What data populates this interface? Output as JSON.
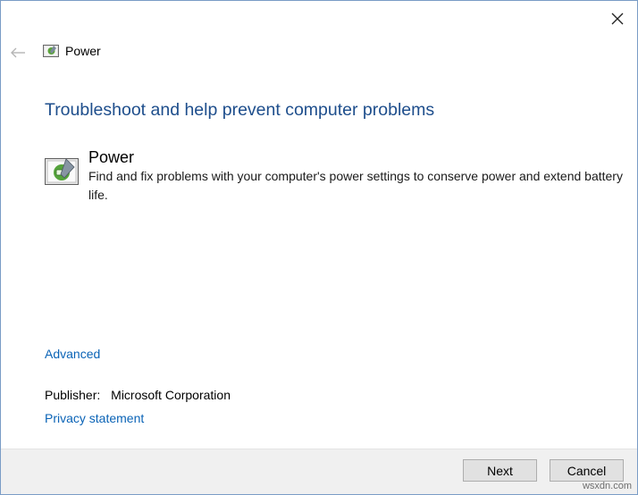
{
  "window": {
    "nav_title": "Power",
    "nav_icon": "power-troubleshooter-icon",
    "back_icon": "back-arrow-icon",
    "close_icon": "close-icon"
  },
  "main": {
    "heading": "Troubleshoot and help prevent computer problems",
    "item": {
      "icon": "battery-troubleshooter-icon",
      "title": "Power",
      "description": "Find and fix problems with your computer's power settings to conserve power and extend battery life."
    },
    "advanced_link": "Advanced",
    "publisher_label": "Publisher:",
    "publisher_value": "Microsoft Corporation",
    "privacy_link": "Privacy statement"
  },
  "footer": {
    "next_label": "Next",
    "cancel_label": "Cancel",
    "watermark": "wsxdn.com"
  },
  "colors": {
    "heading": "#1e4e8c",
    "link": "#0a63b6",
    "footer_bg": "#f0f0f0",
    "border": "#7a9cc6"
  }
}
